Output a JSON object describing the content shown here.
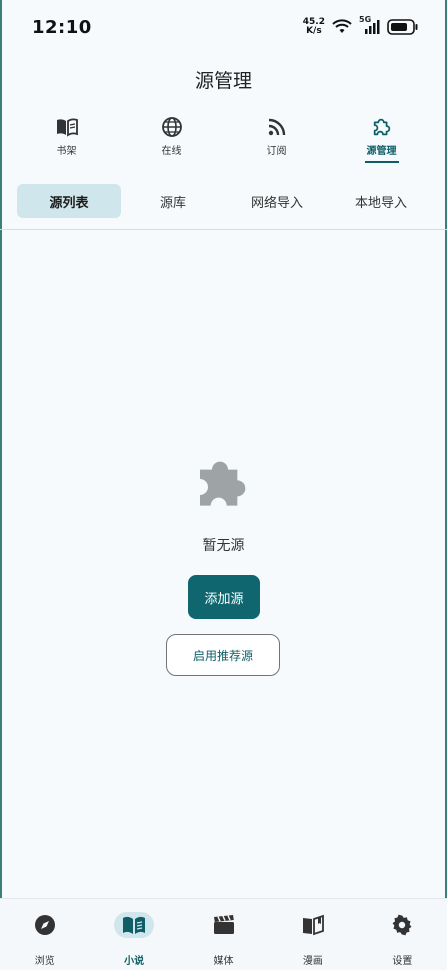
{
  "status_bar": {
    "time": "12:10",
    "net_speed_value": "45.2",
    "net_speed_unit": "K/s",
    "signal_label": "5G"
  },
  "title": "源管理",
  "top_tabs": [
    {
      "label": "书架",
      "icon": "book-icon"
    },
    {
      "label": "在线",
      "icon": "globe-icon"
    },
    {
      "label": "订阅",
      "icon": "rss-icon"
    },
    {
      "label": "源管理",
      "icon": "puzzle-icon",
      "active": true
    }
  ],
  "sub_tabs": [
    {
      "label": "源列表",
      "active": true
    },
    {
      "label": "源库"
    },
    {
      "label": "网络导入"
    },
    {
      "label": "本地导入"
    }
  ],
  "empty_state": {
    "icon": "puzzle-icon",
    "message": "暂无源",
    "add_button": "添加源",
    "recommend_button": "启用推荐源"
  },
  "bottom_nav": [
    {
      "label": "浏览",
      "icon": "compass-icon"
    },
    {
      "label": "小说",
      "icon": "book-open-icon",
      "active": true
    },
    {
      "label": "媒体",
      "icon": "clapperboard-icon"
    },
    {
      "label": "漫画",
      "icon": "manga-book-icon"
    },
    {
      "label": "设置",
      "icon": "gear-icon"
    }
  ],
  "colors": {
    "accent": "#0f666e",
    "active_bg": "#cfe6ec",
    "background": "#f6fafc",
    "empty_icon": "#9ea3a6"
  }
}
